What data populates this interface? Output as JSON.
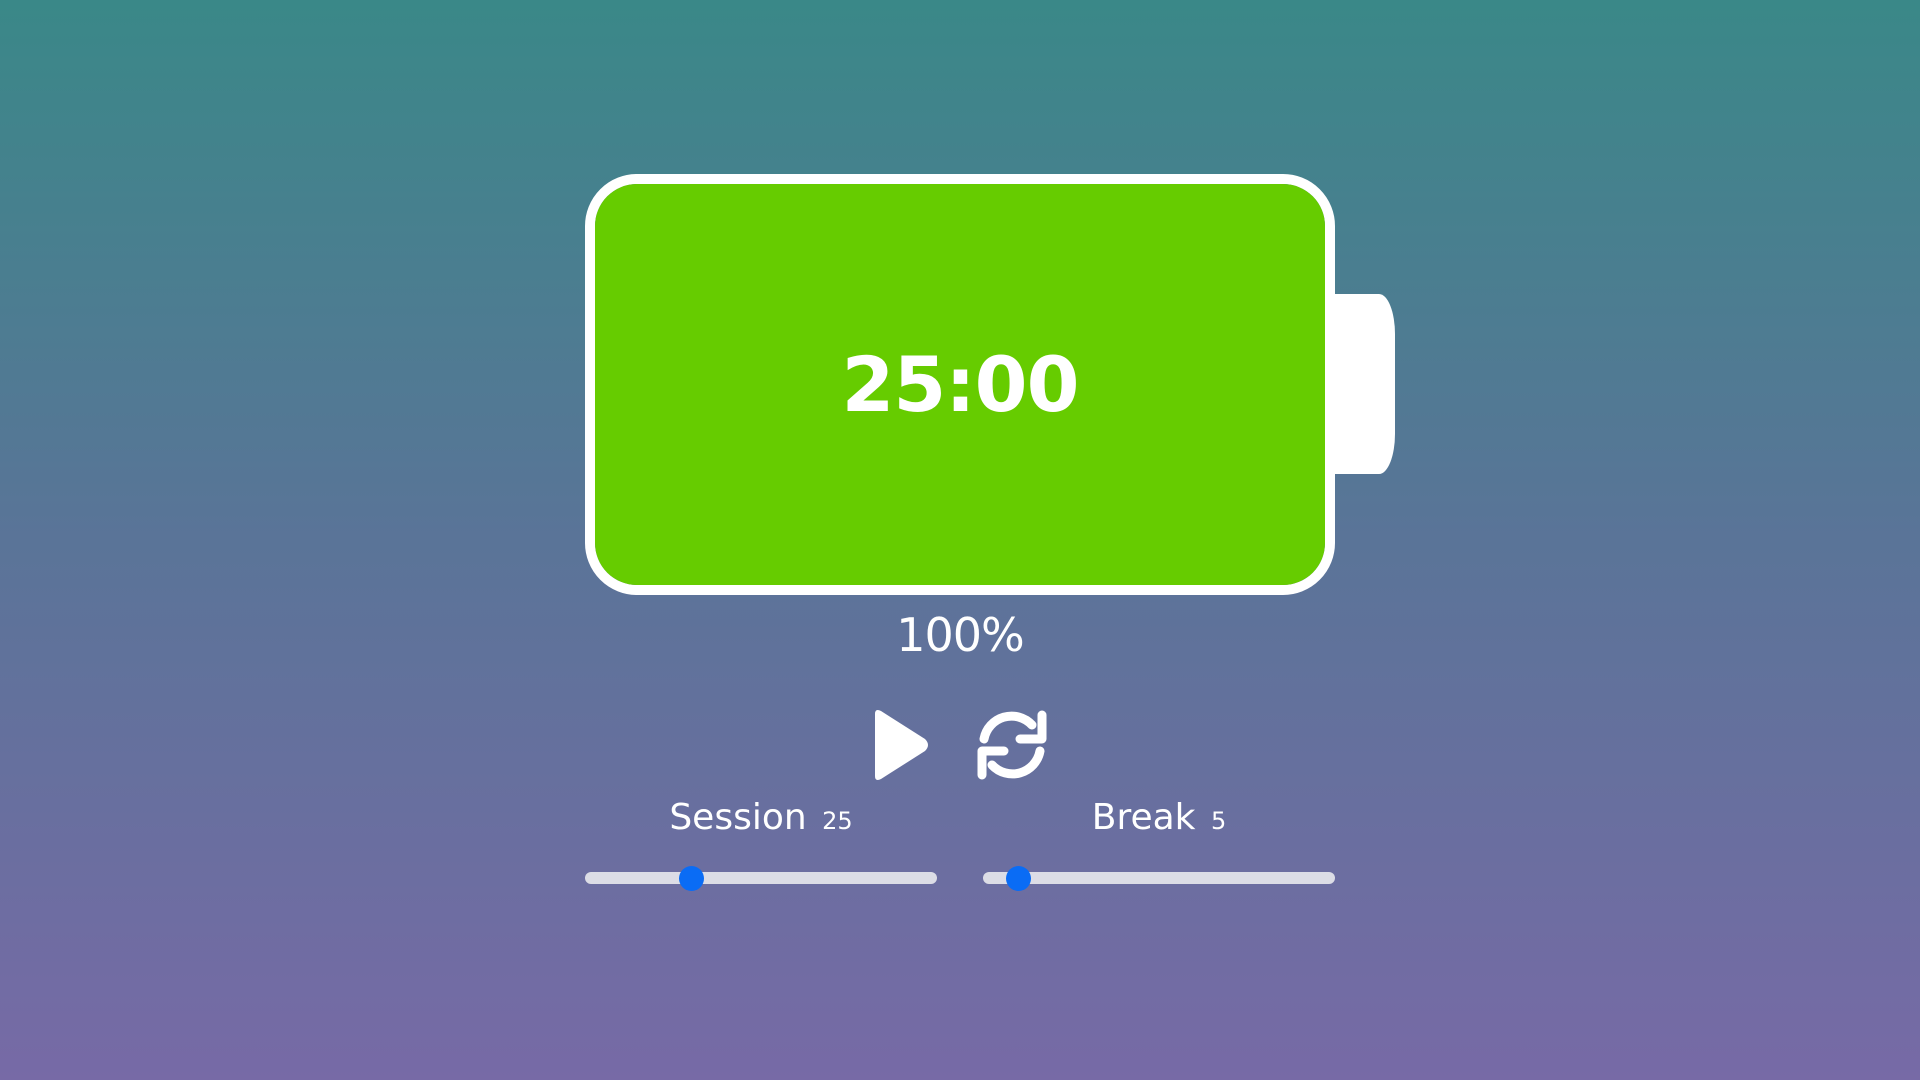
{
  "timer": {
    "display": "25:00",
    "battery_percent_label": "100%",
    "battery_level": 100
  },
  "controls": {
    "play_icon": "play-icon",
    "reset_icon": "refresh-icon"
  },
  "session": {
    "label": "Session",
    "value": "25",
    "slider_fraction": 0.3
  },
  "break": {
    "label": "Break",
    "value": "5",
    "slider_fraction": 0.1
  },
  "colors": {
    "battery_fill": "#66cc00",
    "slider_thumb": "#0a6cf5",
    "slider_track": "#dcdde6",
    "foreground": "#ffffff"
  }
}
